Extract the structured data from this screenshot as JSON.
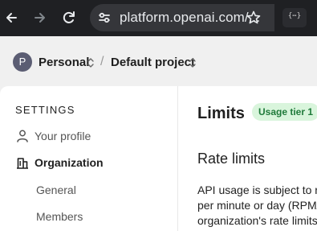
{
  "browser": {
    "url": "platform.openai.com/...",
    "extension_badge": "{⋯}"
  },
  "project_bar": {
    "avatar_letter": "P",
    "org_name": "Personal",
    "separator": "/",
    "project_name": "Default project"
  },
  "sidebar": {
    "heading": "SETTINGS",
    "items": [
      {
        "label": "Your profile",
        "icon": "person-icon"
      },
      {
        "label": "Organization",
        "icon": "building-icon"
      }
    ],
    "sub_items": [
      "General",
      "Members"
    ]
  },
  "main": {
    "title": "Limits",
    "badge": "Usage tier 1",
    "section_title": "Rate limits",
    "paragraph_lines": [
      "API usage is subject to r",
      "per minute or day (RPM/",
      "organization's rate limits"
    ]
  },
  "colors": {
    "chrome_bg": "#1f2023",
    "badge_bg": "#d9f5dc",
    "badge_text": "#1f7a3a"
  }
}
